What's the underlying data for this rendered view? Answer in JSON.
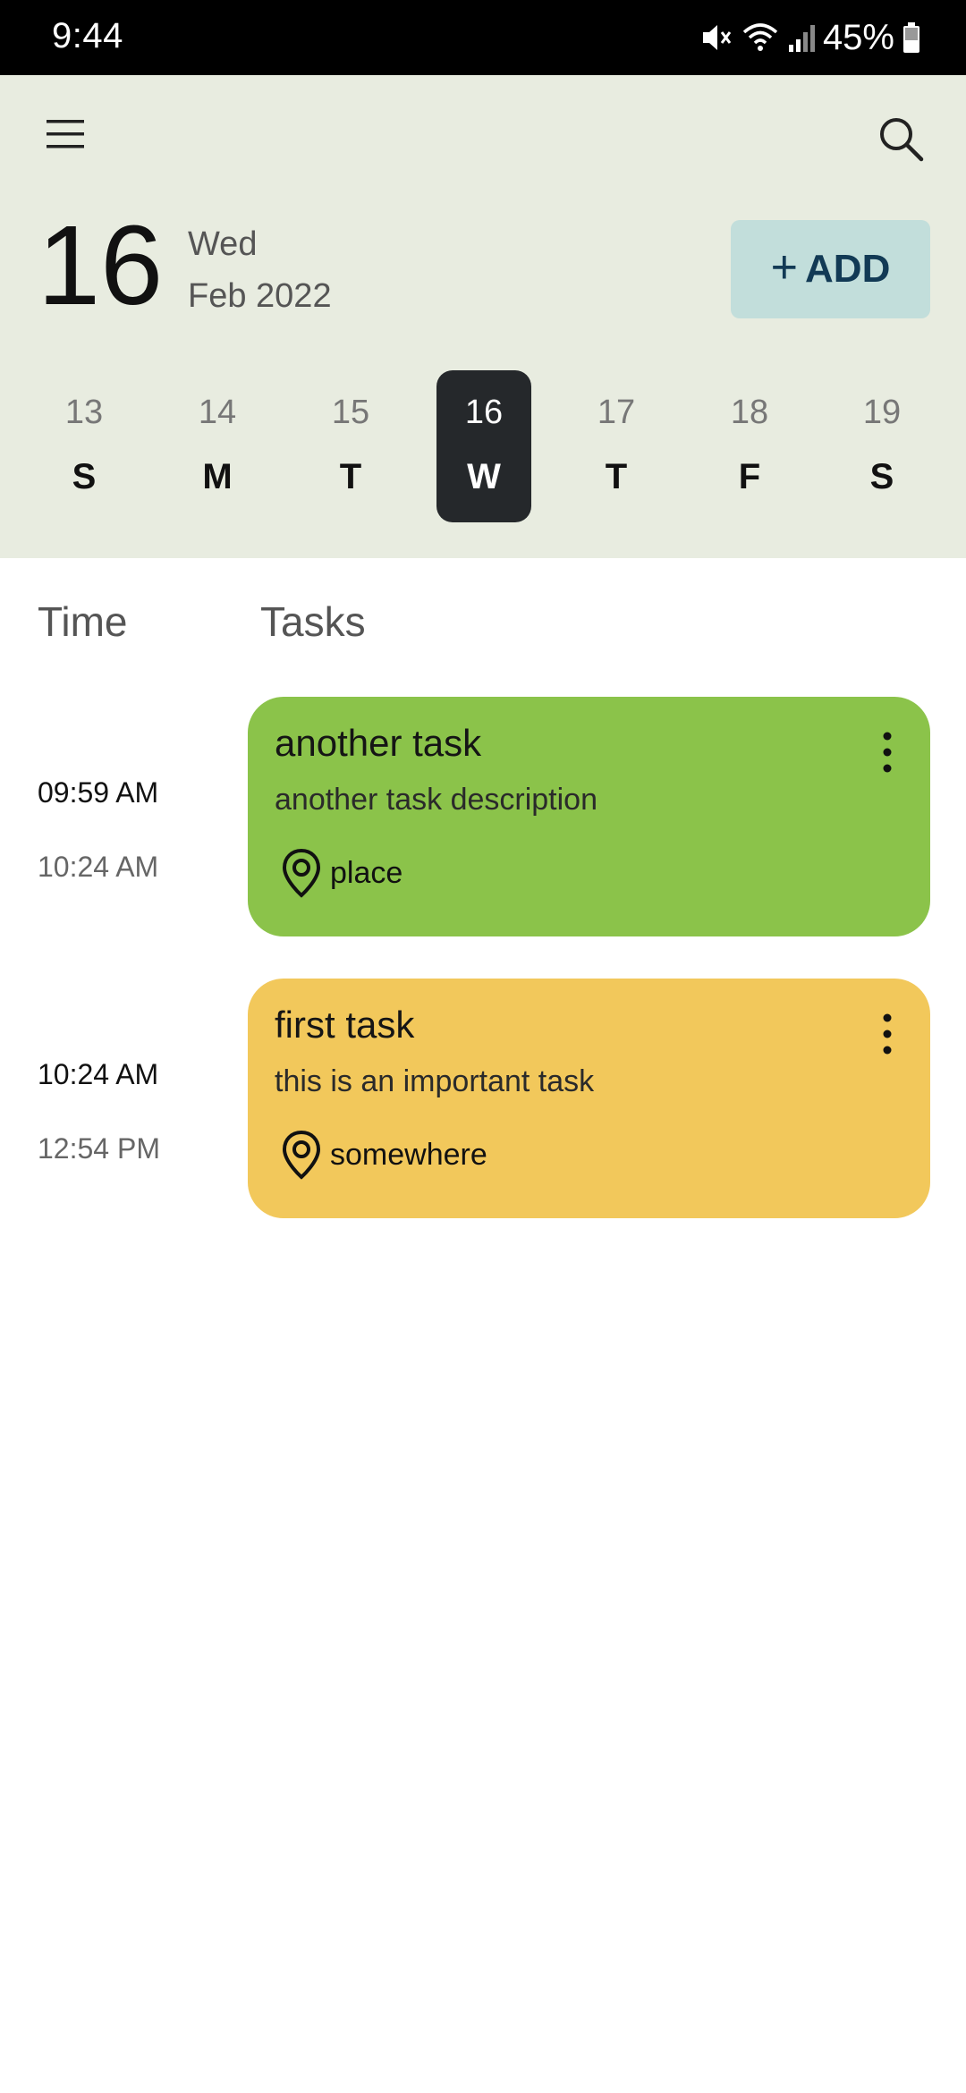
{
  "status_bar": {
    "time": "9:44",
    "battery": "45%",
    "icons": [
      "mute-icon",
      "wifi-icon",
      "signal-icon",
      "battery-icon"
    ]
  },
  "header": {
    "menu_icon": "menu-icon",
    "search_icon": "search-icon",
    "day_number": "16",
    "weekday": "Wed",
    "month_year": "Feb 2022",
    "add_label": "ADD",
    "add_icon": "+",
    "background": "#e8ece0",
    "add_background": "#c2dedb"
  },
  "week": [
    {
      "num": "13",
      "letter": "S",
      "selected": false
    },
    {
      "num": "14",
      "letter": "M",
      "selected": false
    },
    {
      "num": "15",
      "letter": "T",
      "selected": false
    },
    {
      "num": "16",
      "letter": "W",
      "selected": true
    },
    {
      "num": "17",
      "letter": "T",
      "selected": false
    },
    {
      "num": "18",
      "letter": "F",
      "selected": false
    },
    {
      "num": "19",
      "letter": "S",
      "selected": false
    }
  ],
  "columns": {
    "time_header": "Time",
    "tasks_header": "Tasks"
  },
  "tasks": [
    {
      "start": "09:59 AM",
      "end": "10:24 AM",
      "title": "another task",
      "description": "another task description",
      "location": "place",
      "color": "#8bc34a"
    },
    {
      "start": "10:24 AM",
      "end": "12:54 PM",
      "title": "first task",
      "description": "this is an important task",
      "location": "somewhere",
      "color": "#f2c85b"
    }
  ]
}
